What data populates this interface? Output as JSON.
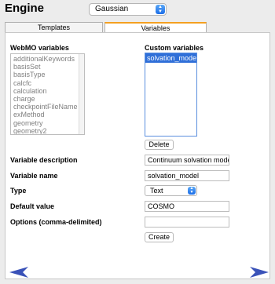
{
  "header": {
    "engine_label": "Engine",
    "engine_value": "Gaussian"
  },
  "tabs": [
    {
      "label": "Templates"
    },
    {
      "label": "Variables"
    }
  ],
  "webmo": {
    "title": "WebMO variables",
    "items": [
      "additionalKeywords",
      "basisSet",
      "basisType",
      "calcfc",
      "calculation",
      "charge",
      "checkpointFileName",
      "exMethod",
      "geometry",
      "geometry2"
    ]
  },
  "custom": {
    "title": "Custom variables",
    "items": [
      "solvation_model"
    ]
  },
  "buttons": {
    "delete": "Delete",
    "create": "Create"
  },
  "form": {
    "description_label": "Variable description",
    "description_value": "Continuum solvation mode",
    "name_label": "Variable name",
    "name_value": "solvation_model",
    "type_label": "Type",
    "type_value": "Text",
    "default_label": "Default value",
    "default_value": "COSMO",
    "options_label": "Options (comma-delimited)",
    "options_value": ""
  },
  "colors": {
    "accent": "#2f6fd8",
    "tab_active": "#f4a020",
    "nav_arrow": "#3a52b8"
  },
  "icons": {
    "prev": "left-arrow-icon",
    "next": "right-arrow-icon",
    "select": "chevron-updown-icon"
  }
}
